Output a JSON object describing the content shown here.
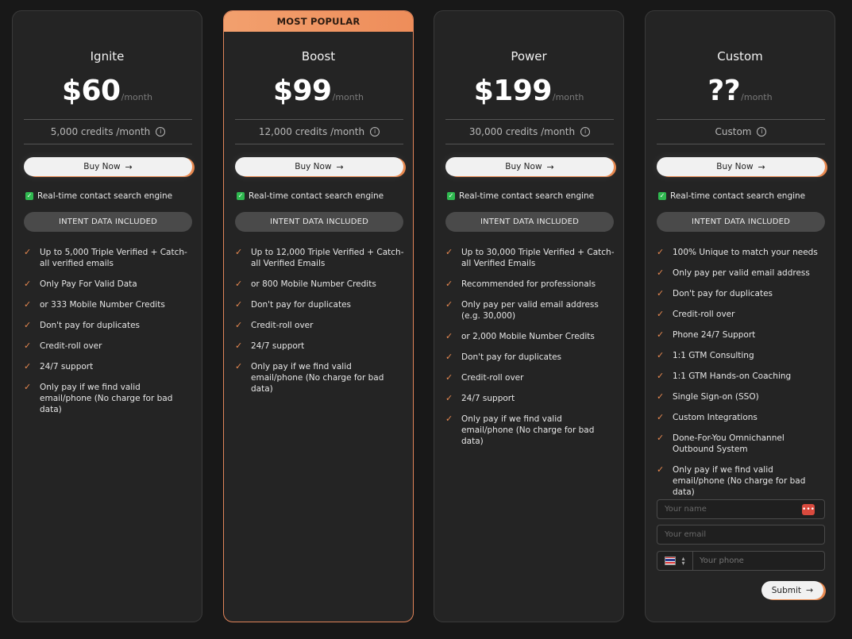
{
  "common": {
    "per_month": "/month",
    "buy_now": "Buy Now",
    "realtime": "Real-time contact search engine",
    "intent": "INTENT DATA INCLUDED",
    "info_icon": "info-icon",
    "arrow_icon": "arrow-right-icon",
    "accent_color": "#e88950"
  },
  "popular_badge": "MOST POPULAR",
  "plans": [
    {
      "name": "Ignite",
      "price": "$60",
      "credits": "5,000 credits /month",
      "features": [
        "Up to 5,000 Triple Verified + Catch-all verified emails",
        "Only Pay For Valid Data",
        "or 333 Mobile Number Credits",
        "Don't pay for duplicates",
        "Credit-roll over",
        "24/7 support",
        "Only pay if we find valid email/phone (No charge for bad data)"
      ]
    },
    {
      "name": "Boost",
      "price": "$99",
      "credits": "12,000 credits /month",
      "features": [
        "Up to 12,000 Triple Verified + Catch-all Verified Emails",
        "or 800 Mobile Number Credits",
        "Don't pay for duplicates",
        "Credit-roll over",
        "24/7 support",
        "Only pay if we find valid email/phone (No charge for bad data)"
      ]
    },
    {
      "name": "Power",
      "price": "$199",
      "credits": "30,000 credits /month",
      "features": [
        "Up to 30,000 Triple Verified + Catch-all Verified Emails",
        "Recommended for professionals",
        "Only pay per valid email address (e.g. 30,000)",
        "or 2,000 Mobile Number Credits",
        "Don't pay for duplicates",
        "Credit-roll over",
        "24/7 support",
        "Only pay if we find valid email/phone (No charge for bad data)"
      ]
    },
    {
      "name": "Custom",
      "price": "??",
      "credits": "Custom",
      "features": [
        "100% Unique to match your needs",
        "Only pay per valid email address",
        "Don't pay for duplicates",
        "Credit-roll over",
        "Phone 24/7 Support",
        "1:1 GTM Consulting",
        "1:1 GTM Hands-on Coaching",
        "Single Sign-on (SSO)",
        "Custom Integrations",
        "Done-For-You Omnichannel Outbound System",
        "Only pay if we find valid email/phone (No charge for bad data)"
      ]
    }
  ],
  "form": {
    "name_placeholder": "Your name",
    "email_placeholder": "Your email",
    "phone_placeholder": "Your phone",
    "submit": "Submit",
    "country_flag_icon": "thailand-flag-icon"
  }
}
